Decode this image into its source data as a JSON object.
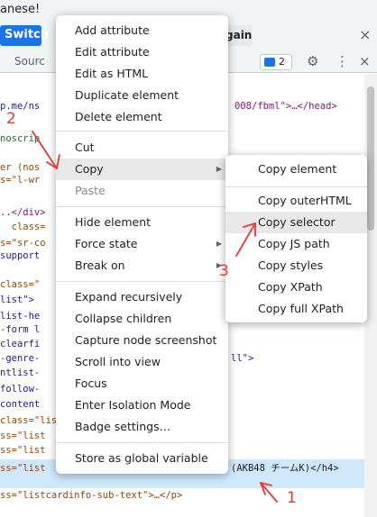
{
  "banner": {
    "text": "anese!",
    "switch_label": "Switch",
    "again_label": "gain",
    "close_glyph": "×"
  },
  "toolbar": {
    "tab_label": "Sourc",
    "issues_count": "2",
    "gear_glyph": "⚙",
    "more_glyph": "⋮",
    "close_glyph": "×"
  },
  "code_lines": [
    {
      "tag": "p.me/ns",
      "mid": "",
      "tail": "008/fbml\">…</head>"
    },
    {
      "tag": "noscrip",
      "mid": "",
      "tail": ""
    },
    {
      "tag": "er (nos",
      "mid": "",
      "tail": ""
    },
    {
      "tag": "s=\"l-wr",
      "mid": "",
      "tail": ""
    },
    {
      "tag": "..</div>",
      "mid": "",
      "tail": ""
    },
    {
      "tag": "  class=",
      "mid": "",
      "tail": ""
    },
    {
      "tag": "s=\"sr-co",
      "mid": "",
      "tail": ""
    },
    {
      "tag": "support",
      "mid": "",
      "tail": ""
    },
    {
      "tag": "class=\"",
      "mid": "",
      "tail": ""
    },
    {
      "tag": "list\">",
      "mid": "",
      "tail": ""
    },
    {
      "tag": "list-he",
      "mid": "",
      "tail": ""
    },
    {
      "tag": "-form l",
      "mid": "",
      "tail": ""
    },
    {
      "tag": "clearfi",
      "mid": "",
      "tail": ""
    },
    {
      "tag": "-genre-",
      "mid": "",
      "tail": "ll\">"
    },
    {
      "tag": "ntlist-",
      "mid": "",
      "tail": ""
    },
    {
      "tag": "follow-",
      "mid": "",
      "tail": ""
    },
    {
      "tag": "content",
      "mid": "",
      "tail": ""
    },
    {
      "tag": "class=\"listca",
      "mid": "",
      "tail": ""
    },
    {
      "tag": "ss=\"list",
      "mid": "",
      "tail": ""
    },
    {
      "tag": "ss=\"list",
      "mid": "",
      "tail": ""
    },
    {
      "tag": "ss=\"list",
      "mid": "",
      "tail": "(AKB48 チームK)</h4>"
    },
    {
      "tag": "ss=\"listcardinfo-sub-text\">…</p>",
      "mid": "",
      "tail": ""
    }
  ],
  "menu": {
    "items": [
      {
        "label": "Add attribute"
      },
      {
        "label": "Edit attribute"
      },
      {
        "label": "Edit as HTML"
      },
      {
        "label": "Duplicate element"
      },
      {
        "label": "Delete element"
      },
      {
        "label": "Cut"
      },
      {
        "label": "Copy"
      },
      {
        "label": "Paste"
      },
      {
        "label": "Hide element"
      },
      {
        "label": "Force state"
      },
      {
        "label": "Break on"
      },
      {
        "label": "Expand recursively"
      },
      {
        "label": "Collapse children"
      },
      {
        "label": "Capture node screenshot"
      },
      {
        "label": "Scroll into view"
      },
      {
        "label": "Focus"
      },
      {
        "label": "Enter Isolation Mode"
      },
      {
        "label": "Badge settings…"
      },
      {
        "label": "Store as global variable"
      }
    ]
  },
  "submenu": {
    "items": [
      {
        "label": "Copy element"
      },
      {
        "label": "Copy outerHTML"
      },
      {
        "label": "Copy selector"
      },
      {
        "label": "Copy JS path"
      },
      {
        "label": "Copy styles"
      },
      {
        "label": "Copy XPath"
      },
      {
        "label": "Copy full XPath"
      }
    ]
  },
  "annotations": {
    "n1": "1",
    "n2": "2",
    "n3": "3",
    "color": "#e53935"
  },
  "arrow_glyph": "▶"
}
